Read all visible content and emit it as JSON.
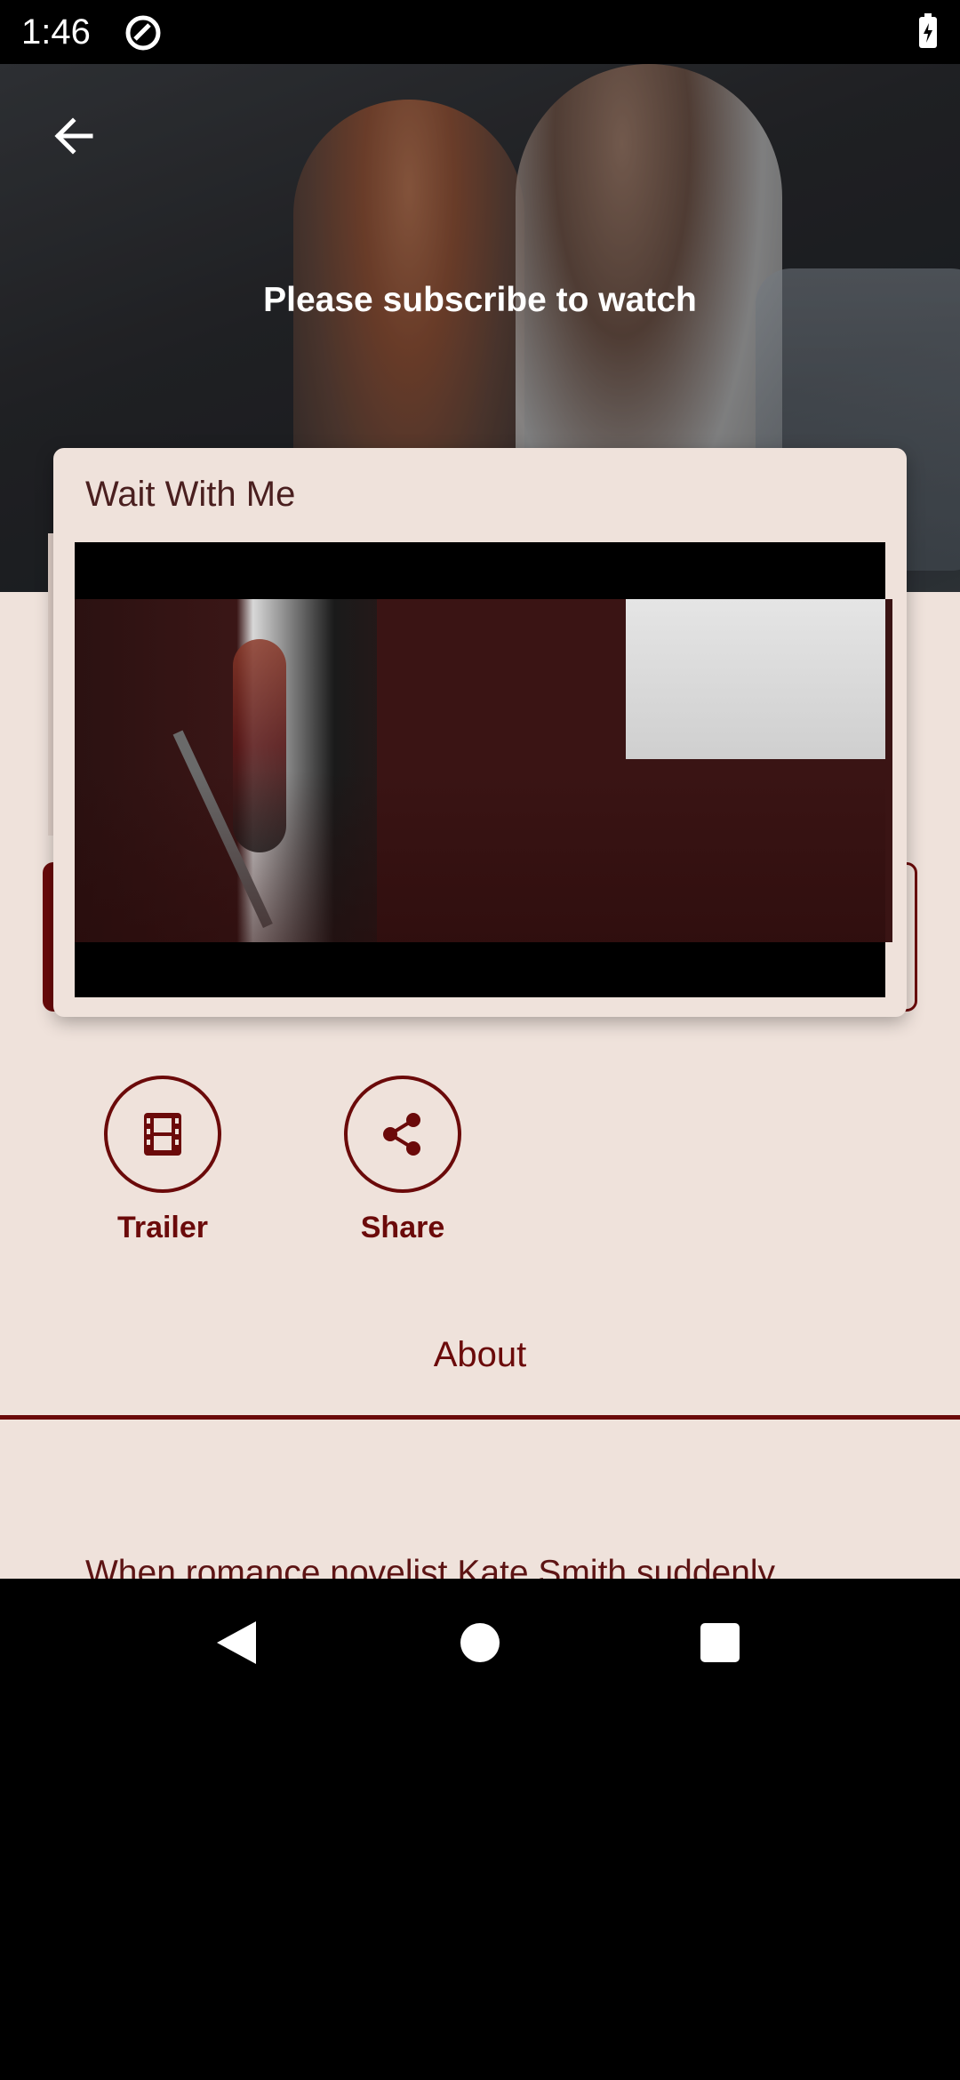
{
  "status_bar": {
    "time": "1:46"
  },
  "hero": {
    "subscribe_message": "Please subscribe to watch"
  },
  "dialog": {
    "title": "Wait With Me"
  },
  "actions": {
    "trailer_label": "Trailer",
    "share_label": "Share"
  },
  "tabs": {
    "about_label": "About"
  },
  "description": {
    "text": "When romance novelist Kate Smith suddenly"
  },
  "colors": {
    "accent": "#6b0a0a",
    "background": "#efe2db"
  },
  "icons": {
    "back": "arrow-left-icon",
    "trailer": "film-strip-icon",
    "share": "share-icon"
  }
}
